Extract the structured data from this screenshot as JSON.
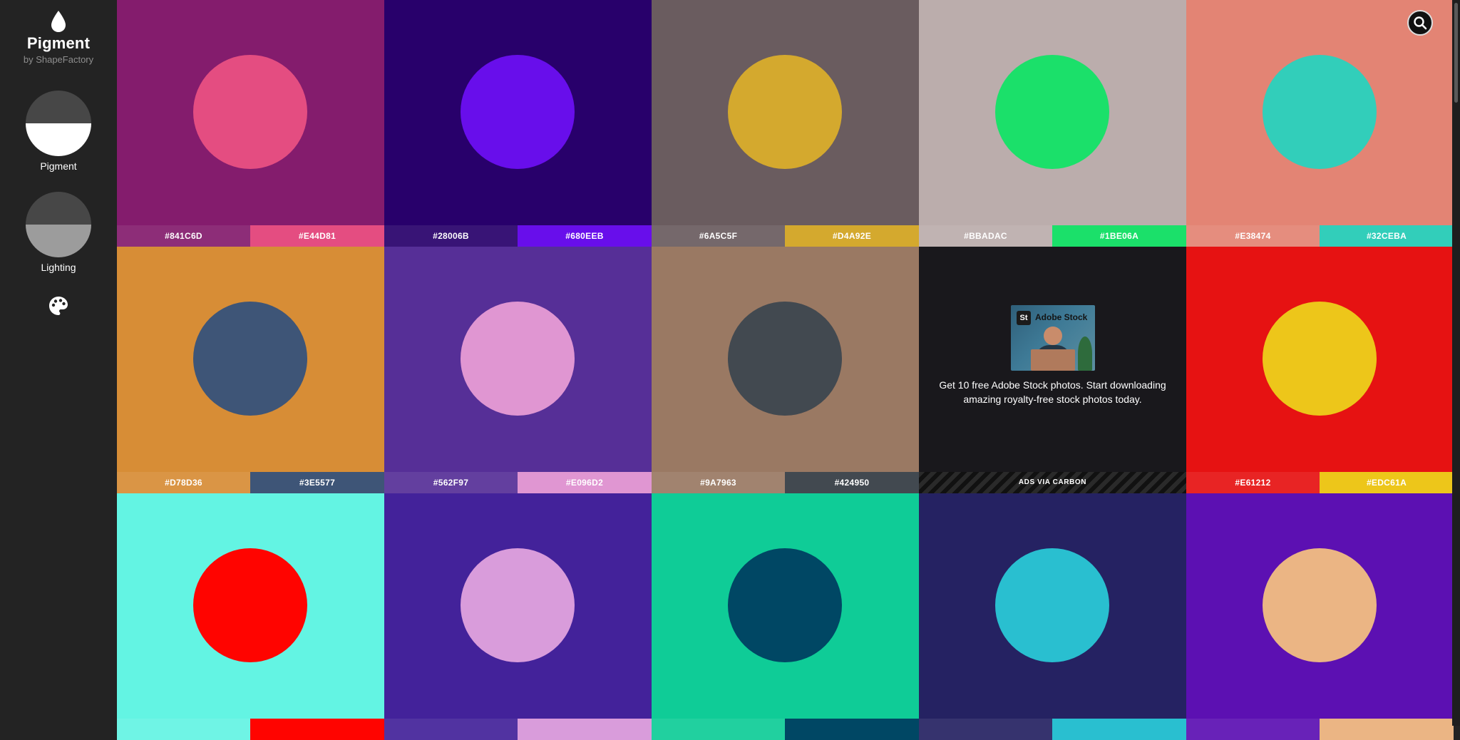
{
  "sidebar": {
    "brand_title": "Pigment",
    "brand_subtitle": "by ShapeFactory",
    "modes": [
      {
        "label": "Pigment",
        "icon": "pigment-mode-icon"
      },
      {
        "label": "Lighting",
        "icon": "lighting-mode-icon"
      }
    ],
    "palette_icon": "palette-icon",
    "logo_icon": "drop-icon"
  },
  "search": {
    "icon": "search-icon"
  },
  "tiles": [
    {
      "bg": "#841C6D",
      "fg": "#E44D81",
      "bg_label": "#841C6D",
      "fg_label": "#E44D81"
    },
    {
      "bg": "#28006B",
      "fg": "#680EEB",
      "bg_label": "#28006B",
      "fg_label": "#680EEB"
    },
    {
      "bg": "#6A5C5F",
      "fg": "#D4A92E",
      "bg_label": "#6A5C5F",
      "fg_label": "#D4A92E"
    },
    {
      "bg": "#BBADAC",
      "fg": "#1BE06A",
      "bg_label": "#BBADAC",
      "fg_label": "#1BE06A"
    },
    {
      "bg": "#E38474",
      "fg": "#32CEBA",
      "bg_label": "#E38474",
      "fg_label": "#32CEBA"
    },
    {
      "bg": "#D78D36",
      "fg": "#3E5577",
      "bg_label": "#D78D36",
      "fg_label": "#3E5577"
    },
    {
      "bg": "#562F97",
      "fg": "#E096D2",
      "bg_label": "#562F97",
      "fg_label": "#E096D2"
    },
    {
      "bg": "#9A7963",
      "fg": "#424950",
      "bg_label": "#9A7963",
      "fg_label": "#424950"
    },
    {
      "bg": "#E61212",
      "fg": "#EDC61A",
      "bg_label": "#E61212",
      "fg_label": "#EDC61A"
    },
    {
      "bg": "#63F4E3",
      "fg": "#FF0400"
    },
    {
      "bg": "#43229A",
      "fg": "#D99CDB"
    },
    {
      "bg": "#0FCC97",
      "fg": "#004764"
    },
    {
      "bg": "#252262",
      "fg": "#29BFD0"
    },
    {
      "bg": "#5C10B2",
      "fg": "#EBB584"
    }
  ],
  "ad": {
    "brand": "Adobe Stock",
    "logo_text": "St",
    "text": "Get 10 free Adobe Stock photos. Start downloading amazing royalty-free stock photos today.",
    "footer": "ADS VIA CARBON"
  }
}
